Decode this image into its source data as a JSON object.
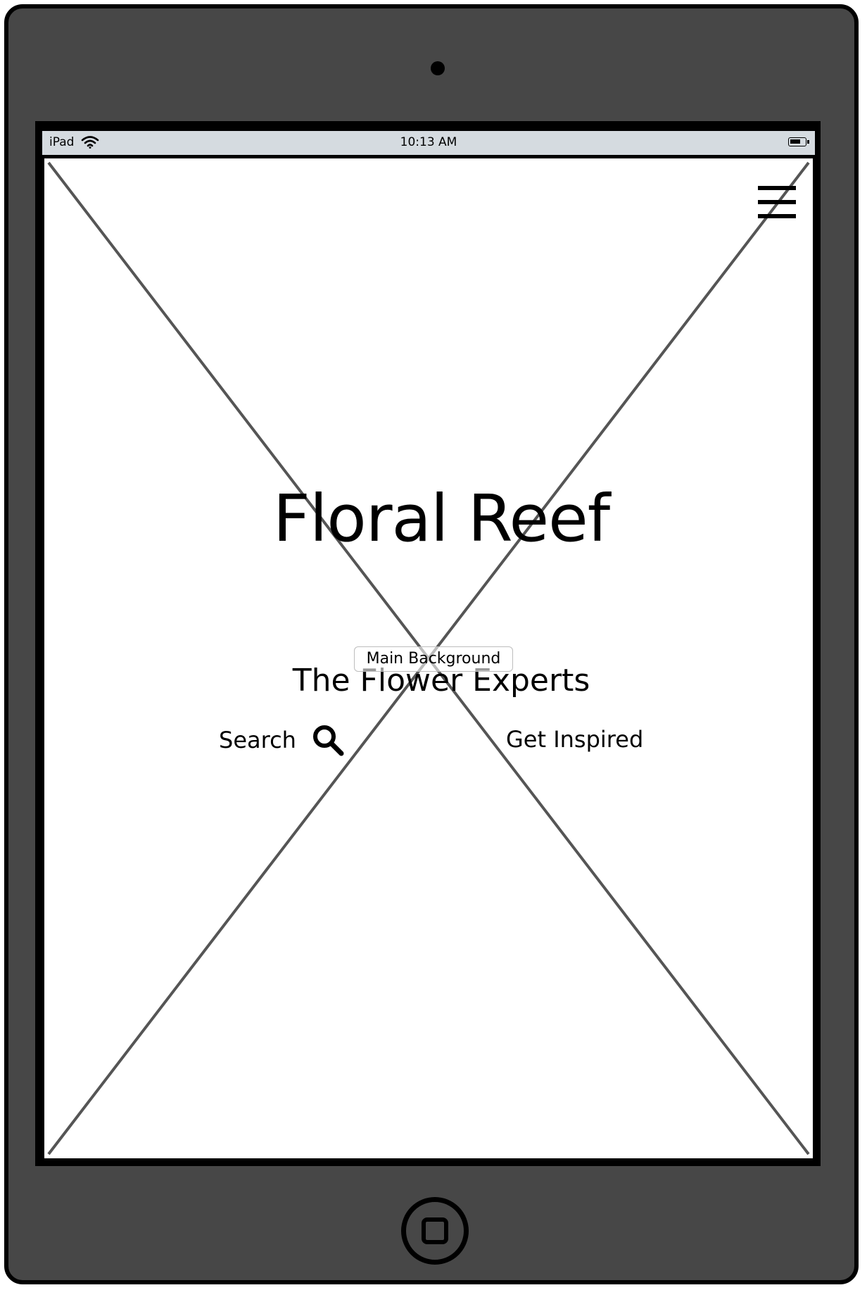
{
  "device": {
    "model": "iPad",
    "time": "10:13 AM"
  },
  "page": {
    "brand": "Floral Reef",
    "tagline": "The Flower Experts",
    "background_label": "Main Background",
    "nav": {
      "search_label": "Search",
      "inspired_label": "Get Inspired"
    }
  },
  "icons": {
    "wifi": "wifi-icon",
    "battery": "battery-icon",
    "menu": "hamburger-menu-icon",
    "search": "search-icon",
    "home": "home-button-icon"
  },
  "colors": {
    "device_body": "#474747",
    "status_bar": "#d5dbe0",
    "placeholder_lines": "#555555"
  }
}
